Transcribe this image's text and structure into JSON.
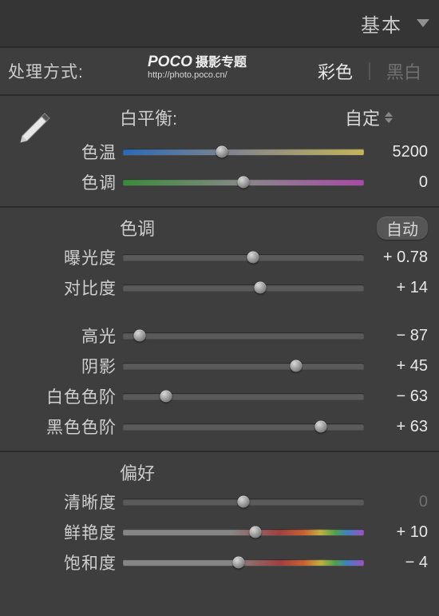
{
  "header": {
    "title": "基本"
  },
  "mode": {
    "label": "处理方式:",
    "color_tab": "彩色",
    "bw_tab": "黑白"
  },
  "watermark": {
    "brand": "POCO",
    "brand_sub": "摄影专题",
    "url": "http://photo.poco.cn/"
  },
  "wb": {
    "title": "白平衡:",
    "selected": "自定",
    "temp": {
      "label": "色温",
      "value": "5200",
      "pos": 41
    },
    "tint": {
      "label": "色调",
      "value": "0",
      "pos": 50
    }
  },
  "tone": {
    "title": "色调",
    "auto_label": "自动",
    "sliders": [
      {
        "label": "曝光度",
        "value": "+ 0.78",
        "pos": 54,
        "kind": "gray"
      },
      {
        "label": "对比度",
        "value": "+ 14",
        "pos": 57,
        "kind": "gray"
      },
      {
        "label": "高光",
        "value": "− 87",
        "pos": 7,
        "kind": "gray"
      },
      {
        "label": "阴影",
        "value": "+ 45",
        "pos": 72,
        "kind": "gray"
      },
      {
        "label": "白色色阶",
        "value": "− 63",
        "pos": 18,
        "kind": "gray"
      },
      {
        "label": "黑色色阶",
        "value": "+ 63",
        "pos": 82,
        "kind": "gray"
      }
    ]
  },
  "presence": {
    "title": "偏好",
    "sliders": [
      {
        "label": "清晰度",
        "value": "0",
        "pos": 50,
        "kind": "gray",
        "zero": true
      },
      {
        "label": "鲜艳度",
        "value": "+ 10",
        "pos": 55,
        "kind": "rainbow"
      },
      {
        "label": "饱和度",
        "value": "− 4",
        "pos": 48,
        "kind": "rainbow"
      }
    ]
  }
}
